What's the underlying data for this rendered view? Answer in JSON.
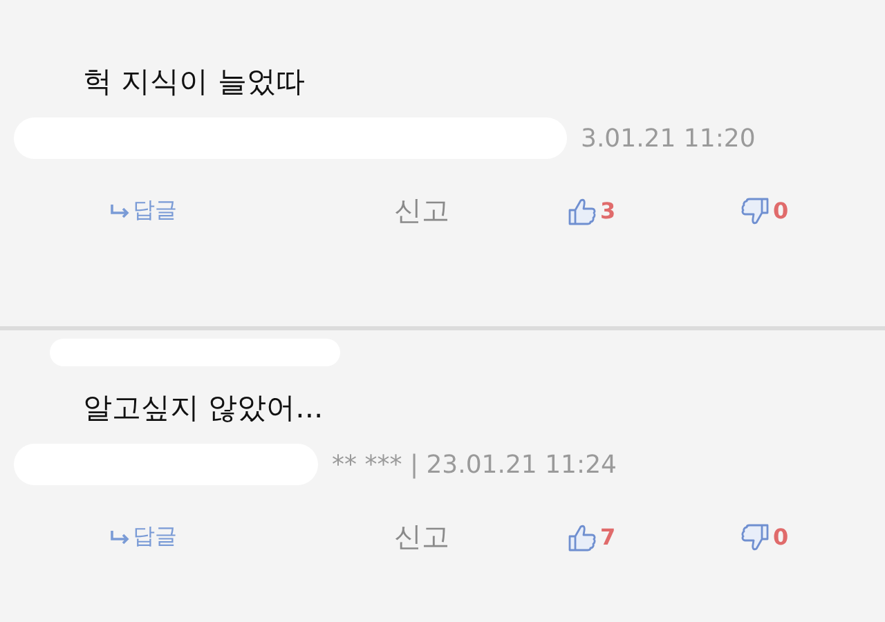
{
  "comments": [
    {
      "text": "헉 지식이 늘었따",
      "meta": "3.01.21 11:20",
      "reply": "답글",
      "report": "신고",
      "likes": "3",
      "dislikes": "0"
    },
    {
      "text": "알고싶지 않았어...",
      "meta": "** *** | 23.01.21 11:24",
      "reply": "답글",
      "report": "신고",
      "likes": "7",
      "dislikes": "0"
    }
  ]
}
